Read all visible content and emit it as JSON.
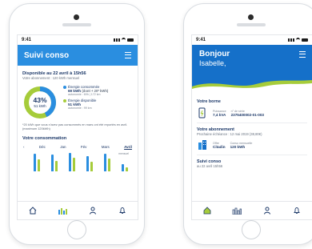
{
  "left_phone": {
    "status_time": "9:41",
    "app_title": "Suivi conso",
    "available_title": "Disponible au 22 avril à 15h56",
    "subscription": "Votre abonnement : 120 kWh mensuel",
    "gauge": {
      "percent": "43%",
      "kwh": "51 kWh",
      "fraction": 0.43
    },
    "consumed": {
      "label": "Énergie consommée",
      "value": "69 kWh",
      "detail": "(dont + 20* kWh)",
      "subtext": "autonomie : 69h | 172 km"
    },
    "available": {
      "label": "Énergie disponible",
      "value": "51 kWh",
      "subtext": "autonomie : 99 km"
    },
    "note": "*20 kWh que vous n'avez pas consommés en mars ont été reportés en avril. (maximum 120kWh)",
    "consumption_title": "Votre consommation",
    "months": [
      "Déc",
      "Jan",
      "Fév",
      "Mars",
      "Avril"
    ],
    "chart_note": "mensuel",
    "bar_levels": [
      0.9,
      0.6,
      0.85,
      0.55,
      0.95,
      0.7,
      0.8,
      0.5,
      0.9,
      0.65,
      0.35,
      0.2
    ]
  },
  "right_phone": {
    "status_time": "9:41",
    "greeting": "Bonjour",
    "name": "Isabelle,",
    "borne_title": "Votre borne",
    "puissance_label": "Puissance",
    "puissance_value": "7,4 kVA",
    "serie_label": "n° de série",
    "serie_value": "2375400002-01-003",
    "abonnement_title": "Votre abonnement",
    "echeance": "Prochaine échéance : 12 mai 2019 (38,80€)",
    "offre_label": "Offre",
    "offre_value": "Citadin",
    "conso_label": "Conso mensuelle",
    "conso_value": "120 kWh",
    "suivi_title": "Suivi conso",
    "suivi_sub": "au 22 avril 15h56"
  },
  "colors": {
    "primary_blue": "#2a8ee0",
    "dark_blue": "#1570c9",
    "green": "#a6cc3a",
    "text_navy": "#1e3a6a"
  },
  "icons": [
    "menu-icon",
    "home-icon",
    "chart-icon",
    "user-icon",
    "bell-icon",
    "charger-icon",
    "building-icon",
    "chevron-left-icon"
  ]
}
